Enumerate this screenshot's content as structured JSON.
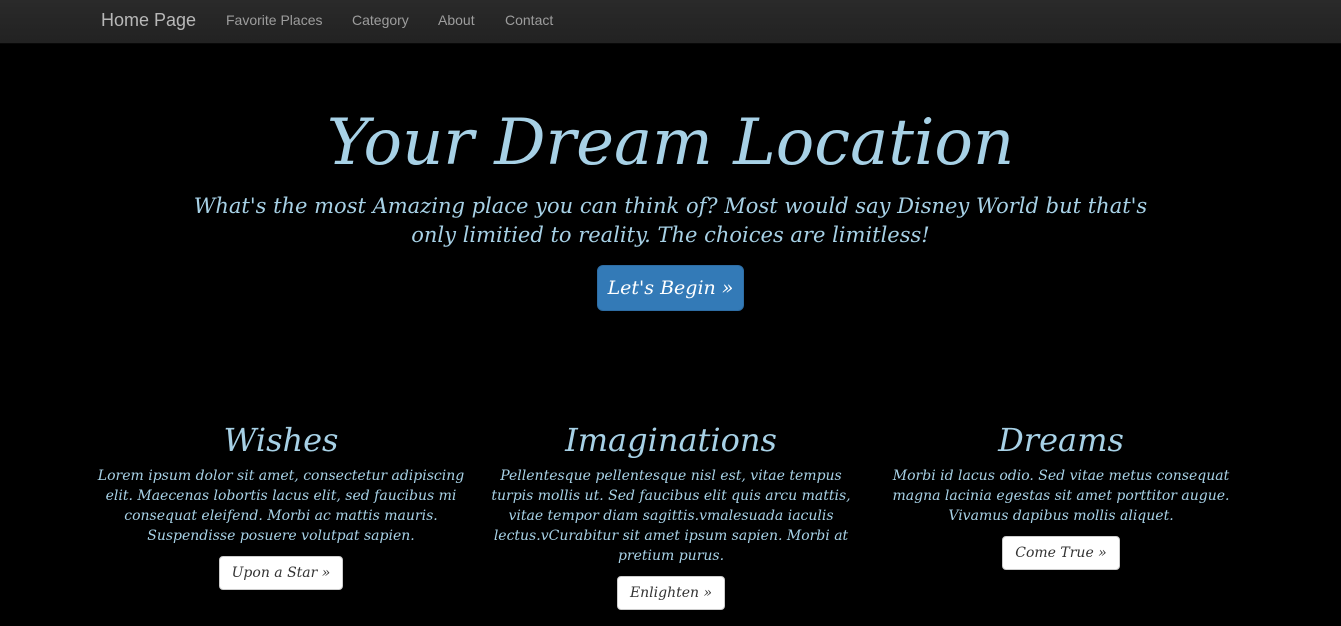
{
  "navbar": {
    "brand": "Home Page",
    "links": [
      "Favorite Places",
      "Category",
      "About",
      "Contact"
    ]
  },
  "hero": {
    "title": "Your Dream Location",
    "subtitle": "What's the most Amazing place you can think of? Most would say Disney World but that's only limitied to reality. The choices are limitless!",
    "button": "Let's Begin »"
  },
  "columns": [
    {
      "heading": "Wishes",
      "text": "Lorem ipsum dolor sit amet, consectetur adipiscing elit. Maecenas lobortis lacus elit, sed faucibus mi consequat eleifend. Morbi ac mattis mauris. Suspendisse posuere volutpat sapien.",
      "button": "Upon a Star »"
    },
    {
      "heading": "Imaginations",
      "text": "Pellentesque pellentesque nisl est, vitae tempus turpis mollis ut. Sed faucibus elit quis arcu mattis, vitae tempor diam sagittis.vmalesuada iaculis lectus.vCurabitur sit amet ipsum sapien. Morbi at pretium purus.",
      "button": "Enlighten »"
    },
    {
      "heading": "Dreams",
      "text": "Morbi id lacus odio. Sed vitae metus consequat magna lacinia egestas sit amet porttitor augue. Vivamus dapibus mollis aliquet.",
      "button": "Come True »"
    }
  ],
  "colors": {
    "page_background": "#000000",
    "navbar_background": "#222222",
    "accent_text": "#a7d1e6",
    "primary_button": "#337ab7"
  }
}
